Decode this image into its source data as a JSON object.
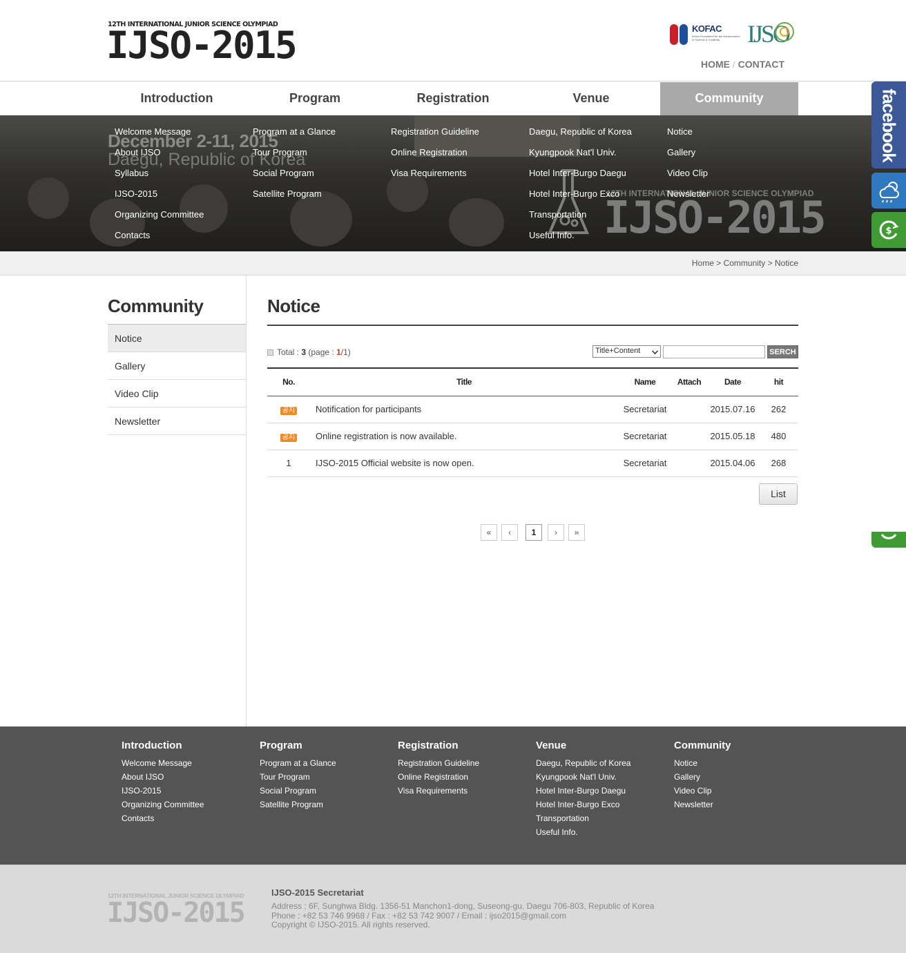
{
  "header": {
    "logo_tagline": "12TH INTERNATIONAL JUNIOR SCIENCE OLYMPIAD",
    "logo_main": "IJSO-2015",
    "partner_logo_1": "KOFAC",
    "partner_logo_1_sub": "Korea Foundation for the Advancement of Science & Creativity",
    "partner_logo_2": "IJSO",
    "util_home": "HOME",
    "util_sep": "/",
    "util_contact": "CONTACT"
  },
  "gnb": [
    {
      "label": "Introduction",
      "active": false
    },
    {
      "label": "Program",
      "active": false
    },
    {
      "label": "Registration",
      "active": false
    },
    {
      "label": "Venue",
      "active": false
    },
    {
      "label": "Community",
      "active": true
    }
  ],
  "banner": {
    "date": "December 2-11, 2015",
    "location": "Daegu, Republic of Korea",
    "logo_tagline": "12TH INTERNATIONAL JUNIOR SCIENCE OLYMPIAD",
    "logo_main": "IJSO-2015"
  },
  "submenus": [
    [
      "Welcome Message",
      "About IJSO",
      "Syllabus",
      "IJSO-2015",
      "Organizing Committee",
      "Contacts"
    ],
    [
      "Program at a Glance",
      "Tour Program",
      "Social Program",
      "Satellite Program"
    ],
    [
      "Registration Guideline",
      "Online Registration",
      "Visa Requirements"
    ],
    [
      "Daegu, Republic of Korea",
      "Kyungpook Nat'l Univ.",
      "Hotel Inter-Burgo Daegu",
      "Hotel Inter-Burgo Exco",
      "Transportation",
      "Useful Info."
    ],
    [
      "Notice",
      "Gallery",
      "Video Clip",
      "Newsletter"
    ]
  ],
  "quick": {
    "facebook": "facebook",
    "weather_icon": "weather-cloud-icon",
    "currency_icon": "currency-exchange-icon",
    "colors": {
      "facebook": "#3b5998",
      "weather": "#2f79c0",
      "currency": "#3f9b33"
    }
  },
  "breadcrumb": {
    "home": "Home",
    "sep1": ">",
    "section": "Community",
    "sep2": ">",
    "page": "Notice"
  },
  "lnb": {
    "title": "Community",
    "items": [
      {
        "label": "Notice",
        "active": true
      },
      {
        "label": "Gallery",
        "active": false
      },
      {
        "label": "Video Clip",
        "active": false
      },
      {
        "label": "Newsletter",
        "active": false
      }
    ]
  },
  "content": {
    "title": "Notice",
    "total_label": "Total : ",
    "total_count": "3",
    "page_open": " (page : ",
    "page_current": "1",
    "page_total": "/1)",
    "search_select": "Title+Content",
    "search_value": "",
    "search_button": "SERCH",
    "columns": {
      "no": "No.",
      "title": "Title",
      "name": "Name",
      "attach": "Attach",
      "date": "Date",
      "hit": "hit"
    },
    "rows": [
      {
        "no": "공지",
        "notice": true,
        "title": "Notification for participants",
        "name": "Secretariat",
        "attach": "",
        "date": "2015.07.16",
        "hit": "262"
      },
      {
        "no": "공지",
        "notice": true,
        "title": "Online registration is now available.",
        "name": "Secretariat",
        "attach": "",
        "date": "2015.05.18",
        "hit": "480"
      },
      {
        "no": "1",
        "notice": false,
        "title": "IJSO-2015 Official website is now open.",
        "name": "Secretariat",
        "attach": "",
        "date": "2015.04.06",
        "hit": "268"
      }
    ],
    "list_button": "List",
    "pagination": {
      "first": "«",
      "prev": "‹",
      "current": "1",
      "next": "›",
      "last": "»"
    }
  },
  "footer": {
    "columns": [
      {
        "title": "Introduction",
        "links": [
          "Welcome Message",
          "About IJSO",
          "IJSO-2015",
          "Organizing Committee",
          "Contacts"
        ]
      },
      {
        "title": "Program",
        "links": [
          "Program at a Glance",
          "Tour Program",
          "Social Program",
          "Satellite Program"
        ]
      },
      {
        "title": "Registration",
        "links": [
          "Registration Guideline",
          "Online Registration",
          "Visa Requirements"
        ]
      },
      {
        "title": "Venue",
        "links": [
          "Daegu, Republic of Korea",
          "Kyungpook Nat'l Univ.",
          "Hotel Inter-Burgo Daegu",
          "Hotel Inter-Burgo Exco",
          "Transportation",
          "Useful Info."
        ]
      },
      {
        "title": "Community",
        "links": [
          "Notice",
          "Gallery",
          "Video Clip",
          "Newsletter"
        ]
      }
    ],
    "logo_tagline": "12TH INTERNATIONAL JUNIOR SCIENCE OLYMPIAD",
    "logo_main": "IJSO-2015",
    "org": "IJSO-2015 Secretariat",
    "address": "Address : 6F, Sunghwa Bldg. 1356-51 Manchon1-dong, Suseong-gu, Daegu 706-803, Republic of Korea",
    "phone": "Phone : +82 53 746 9968 / Fax : +82 53 742 9007 / Email : ijso2015@gmail.com",
    "copyright": "Copyright © IJSO-2015. All rights reserved."
  }
}
